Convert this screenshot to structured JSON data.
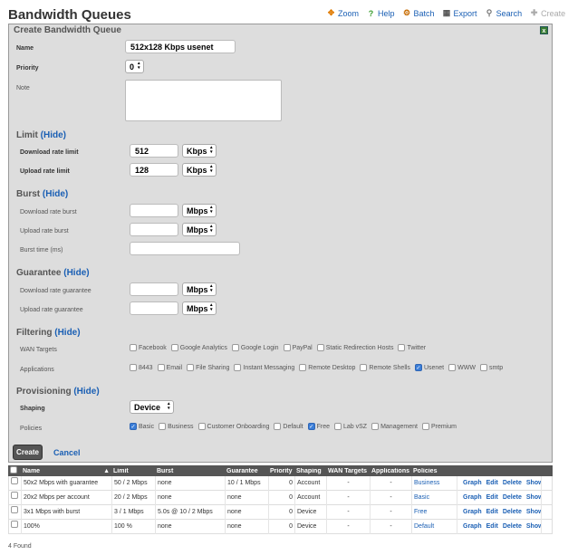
{
  "title": "Bandwidth Queues",
  "toolbar": [
    {
      "icon": "zoom-icon",
      "label": "Zoom"
    },
    {
      "icon": "help-icon",
      "label": "Help"
    },
    {
      "icon": "batch-icon",
      "label": "Batch"
    },
    {
      "icon": "export-icon",
      "label": "Export"
    },
    {
      "icon": "search-icon",
      "label": "Search"
    },
    {
      "icon": "create-new-icon",
      "label": "Create New"
    }
  ],
  "form": {
    "heading": "Create Bandwidth Queue",
    "name_label": "Name",
    "name_value": "512x128 Kbps usenet",
    "priority_label": "Priority",
    "priority_value": "0",
    "note_label": "Note",
    "limit": {
      "title": "Limit",
      "hide": "(Hide)",
      "download_label": "Download rate limit",
      "download_value": "512",
      "download_unit": "Kbps",
      "upload_label": "Upload rate limit",
      "upload_value": "128",
      "upload_unit": "Kbps"
    },
    "burst": {
      "title": "Burst",
      "hide": "(Hide)",
      "download_label": "Download rate burst",
      "download_unit": "Mbps",
      "upload_label": "Upload rate burst",
      "upload_unit": "Mbps",
      "time_label": "Burst time (ms)"
    },
    "guarantee": {
      "title": "Guarantee",
      "hide": "(Hide)",
      "download_label": "Download rate guarantee",
      "download_unit": "Mbps",
      "upload_label": "Upload rate guarantee",
      "upload_unit": "Mbps"
    },
    "filtering": {
      "title": "Filtering",
      "hide": "(Hide)",
      "wan_label": "WAN Targets",
      "wan_targets": [
        {
          "label": "Facebook",
          "checked": false
        },
        {
          "label": "Google Analytics",
          "checked": false
        },
        {
          "label": "Google Login",
          "checked": false
        },
        {
          "label": "PayPal",
          "checked": false
        },
        {
          "label": "Static Redirection Hosts",
          "checked": false
        },
        {
          "label": "Twitter",
          "checked": false
        }
      ],
      "apps_label": "Applications",
      "applications": [
        {
          "label": "8443",
          "checked": false
        },
        {
          "label": "Email",
          "checked": false
        },
        {
          "label": "File Sharing",
          "checked": false
        },
        {
          "label": "Instant Messaging",
          "checked": false
        },
        {
          "label": "Remote Desktop",
          "checked": false
        },
        {
          "label": "Remote Shells",
          "checked": false
        },
        {
          "label": "Usenet",
          "checked": true
        },
        {
          "label": "WWW",
          "checked": false
        },
        {
          "label": "smtp",
          "checked": false
        }
      ]
    },
    "provisioning": {
      "title": "Provisioning",
      "hide": "(Hide)",
      "shaping_label": "Shaping",
      "shaping_value": "Device",
      "policies_label": "Policies",
      "policies": [
        {
          "label": "Basic",
          "checked": true
        },
        {
          "label": "Business",
          "checked": false
        },
        {
          "label": "Customer Onboarding",
          "checked": false
        },
        {
          "label": "Default",
          "checked": false
        },
        {
          "label": "Free",
          "checked": true
        },
        {
          "label": "Lab vSZ",
          "checked": false
        },
        {
          "label": "Management",
          "checked": false
        },
        {
          "label": "Premium",
          "checked": false
        }
      ]
    },
    "create_label": "Create",
    "cancel_label": "Cancel"
  },
  "table": {
    "headers": [
      "Name",
      "Limit",
      "Burst",
      "Guarantee",
      "Priority",
      "Shaping",
      "WAN Targets",
      "Applications",
      "Policies"
    ],
    "rows": [
      {
        "name": "50x2 Mbps with guarantee",
        "limit": "50 / 2 Mbps",
        "burst": "none",
        "guarantee": "10 / 1 Mbps",
        "priority": "0",
        "shaping": "Account",
        "wan": "-",
        "apps": "-",
        "policies": "Business"
      },
      {
        "name": "20x2 Mbps per account",
        "limit": "20 / 2 Mbps",
        "burst": "none",
        "guarantee": "none",
        "priority": "0",
        "shaping": "Account",
        "wan": "-",
        "apps": "-",
        "policies": "Basic"
      },
      {
        "name": "3x1 Mbps with burst",
        "limit": "3 / 1 Mbps",
        "burst": "5.0s @ 10 / 2 Mbps",
        "guarantee": "none",
        "priority": "0",
        "shaping": "Device",
        "wan": "-",
        "apps": "-",
        "policies": "Free"
      },
      {
        "name": "100%",
        "limit": "100 %",
        "burst": "none",
        "guarantee": "none",
        "priority": "0",
        "shaping": "Device",
        "wan": "-",
        "apps": "-",
        "policies": "Default"
      }
    ],
    "actions": [
      "Graph",
      "Edit",
      "Delete",
      "Show"
    ],
    "found": "4 Found"
  }
}
